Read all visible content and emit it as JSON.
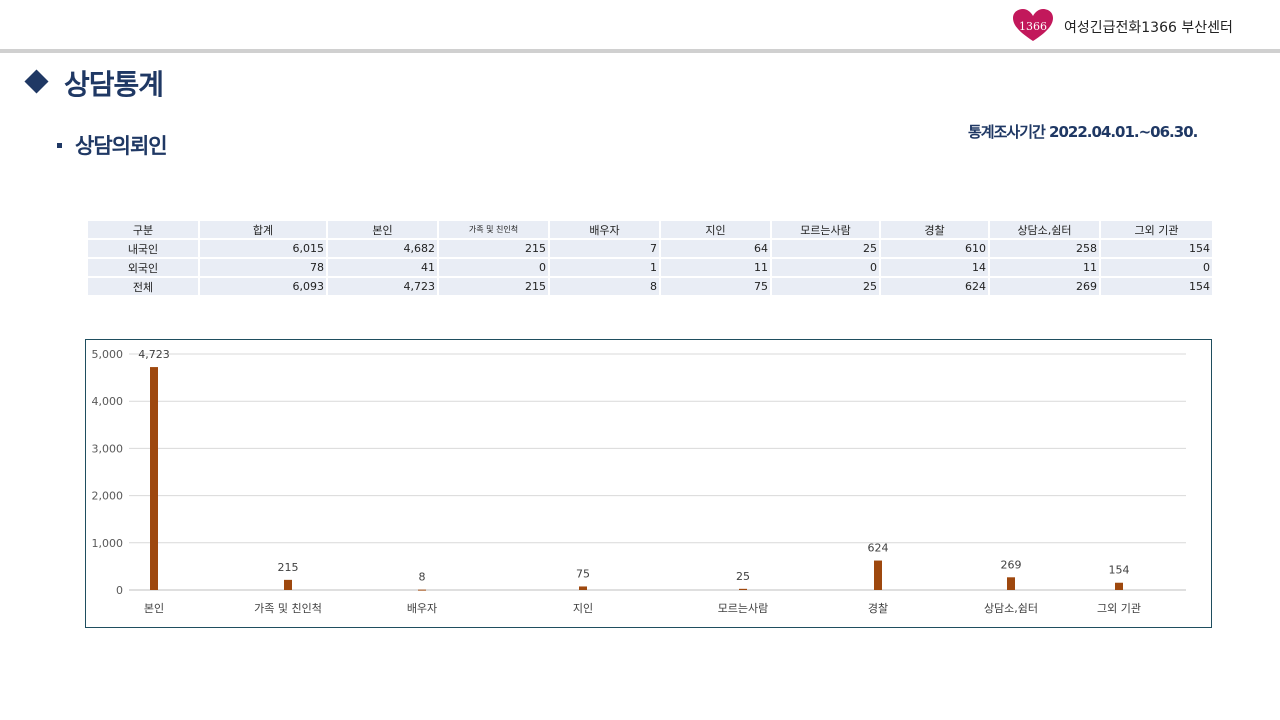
{
  "header": {
    "logo_text": "1366",
    "org_name": "여성긴급전화1366 부산센터"
  },
  "page": {
    "title": "상담통계",
    "section_title": "상담의뢰인",
    "period": "통계조사기간 2022.04.01.~06.30."
  },
  "table": {
    "headers": [
      "구분",
      "합계",
      "본인",
      "가족 및 친인척",
      "배우자",
      "지인",
      "모르는사람",
      "경찰",
      "상담소,쉼터",
      "그외 기관"
    ],
    "rows": [
      {
        "label": "내국인",
        "values": [
          "6,015",
          "4,682",
          "215",
          "7",
          "64",
          "25",
          "610",
          "258",
          "154"
        ]
      },
      {
        "label": "외국인",
        "values": [
          "78",
          "41",
          "0",
          "1",
          "11",
          "0",
          "14",
          "11",
          "0"
        ]
      },
      {
        "label": "전체",
        "values": [
          "6,093",
          "4,723",
          "215",
          "8",
          "75",
          "25",
          "624",
          "269",
          "154"
        ]
      }
    ]
  },
  "chart_data": {
    "type": "bar",
    "categories": [
      "본인",
      "가족 및 친인척",
      "배우자",
      "지인",
      "모르는사람",
      "경찰",
      "상담소,쉼터",
      "그외 기관"
    ],
    "values": [
      4723,
      215,
      8,
      75,
      25,
      624,
      269,
      154
    ],
    "data_labels": [
      "4,723",
      "215",
      "8",
      "75",
      "25",
      "624",
      "269",
      "154"
    ],
    "yticks": [
      "0",
      "1,000",
      "2,000",
      "3,000",
      "4,000",
      "5,000"
    ],
    "ylim": [
      0,
      5000
    ],
    "grid": true,
    "bar_color": "#9e480e",
    "title": "",
    "xlabel": "",
    "ylabel": ""
  },
  "colors": {
    "navy": "#1f3864",
    "cell_bg": "#e9edf5",
    "logo_pink": "#c2185b"
  }
}
